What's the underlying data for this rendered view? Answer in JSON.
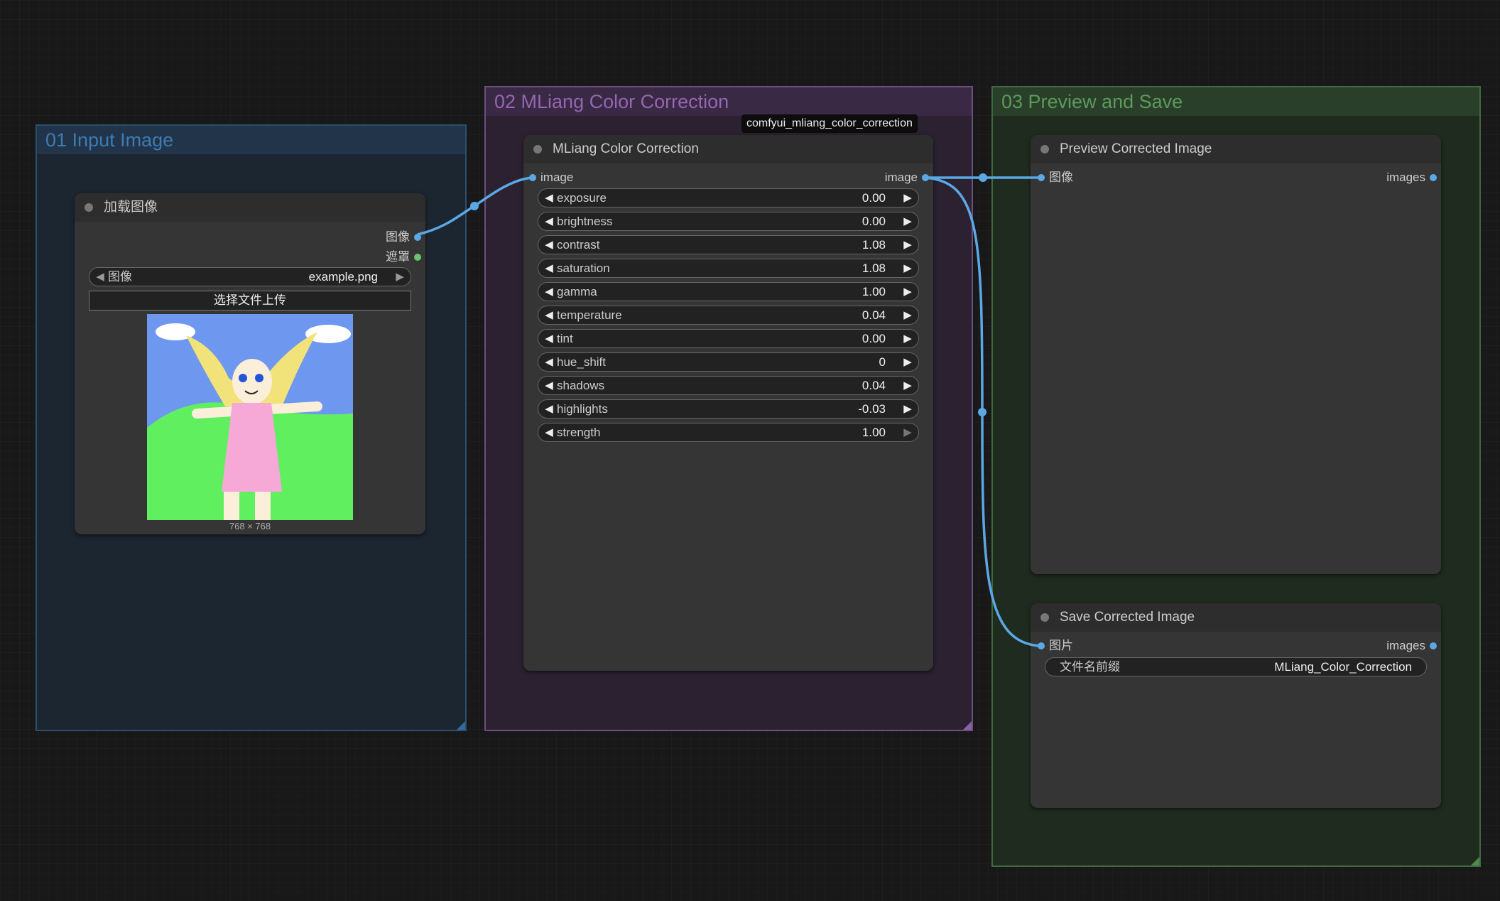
{
  "groups": {
    "input": {
      "title": "01 Input Image"
    },
    "correction": {
      "title": "02 MLiang Color Correction"
    },
    "preview": {
      "title": "03 Preview and Save"
    }
  },
  "load_node": {
    "title": "加载图像",
    "outputs": [
      "图像",
      "遮罩"
    ],
    "image_widget": {
      "label": "图像",
      "value": "example.png"
    },
    "upload_label": "选择文件上传",
    "image_size": "768 × 768"
  },
  "correction_node": {
    "title": "MLiang Color Correction",
    "badge": "comfyui_mliang_color_correction",
    "input": "image",
    "output": "image",
    "params": [
      {
        "name": "exposure",
        "value": "0.00"
      },
      {
        "name": "brightness",
        "value": "0.00"
      },
      {
        "name": "contrast",
        "value": "1.08"
      },
      {
        "name": "saturation",
        "value": "1.08"
      },
      {
        "name": "gamma",
        "value": "1.00"
      },
      {
        "name": "temperature",
        "value": "0.04"
      },
      {
        "name": "tint",
        "value": "0.00"
      },
      {
        "name": "hue_shift",
        "value": "0"
      },
      {
        "name": "shadows",
        "value": "0.04"
      },
      {
        "name": "highlights",
        "value": "-0.03"
      },
      {
        "name": "strength",
        "value": "1.00"
      }
    ]
  },
  "preview_node": {
    "title": "Preview Corrected Image",
    "input": "图像",
    "output": "images"
  },
  "save_node": {
    "title": "Save Corrected Image",
    "input": "图片",
    "output": "images",
    "prefix_label": "文件名前缀",
    "prefix_value": "MLiang_Color_Correction"
  },
  "colors": {
    "link": "#5aa9e6",
    "mask_slot": "#69c46f",
    "input_group": "#3d7bb3",
    "correction_group": "#9466b1",
    "preview_group": "#5b9a5a"
  }
}
